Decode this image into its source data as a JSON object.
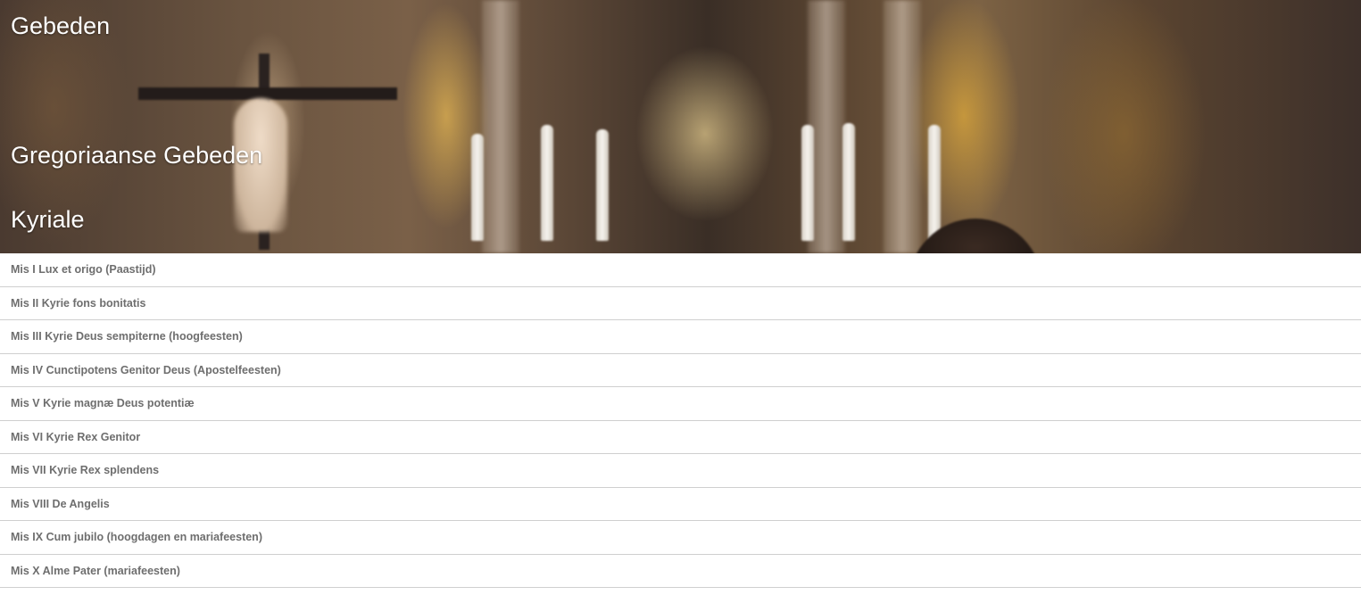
{
  "hero": {
    "title": "Gebeden",
    "subtitle": "Gregoriaanse Gebeden",
    "section": "Kyriale"
  },
  "items": [
    "Mis I Lux et origo (Paastijd)",
    "Mis II Kyrie fons bonitatis",
    "Mis III Kyrie Deus sempiterne (hoogfeesten)",
    "Mis IV Cunctipotens Genitor Deus (Apostelfeesten)",
    "Mis V Kyrie magnæ Deus potentiæ",
    "Mis VI Kyrie Rex Genitor",
    "Mis VII Kyrie Rex splendens",
    "Mis VIII De Angelis",
    "Mis IX Cum jubilo (hoogdagen en mariafeesten)",
    "Mis X Alme Pater (mariafeesten)"
  ]
}
